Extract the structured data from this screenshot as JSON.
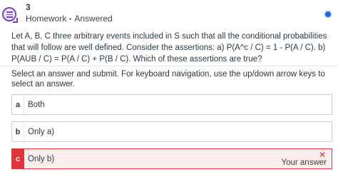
{
  "question": {
    "number": "3",
    "type": "Homework",
    "status": "Answered",
    "text": "Let A, B, C three arbitrary events included in S such that all the conditional probabilities that will follow are well defined. Consider the assertions: a) P(A^c / C) = 1 - P(A / C). b) P(AUB / C) = P(A / C) + P(B / C). Which of these assertions are true?"
  },
  "instructions": "Select an answer and submit. For keyboard navigation, use the up/down arrow keys to select an answer.",
  "options": [
    {
      "letter": "a",
      "label": "Both"
    },
    {
      "letter": "b",
      "label": "Only a)"
    },
    {
      "letter": "c",
      "label": "Only b)",
      "selected": true,
      "status_label": "Your answer",
      "close_glyph": "✕"
    }
  ],
  "colors": {
    "accent": "#7a3fd4",
    "selected_wrong": "#e0333b",
    "info_badge": "#1f66e5"
  },
  "icons": [
    "question-icon",
    "info-icon",
    "close-icon"
  ]
}
